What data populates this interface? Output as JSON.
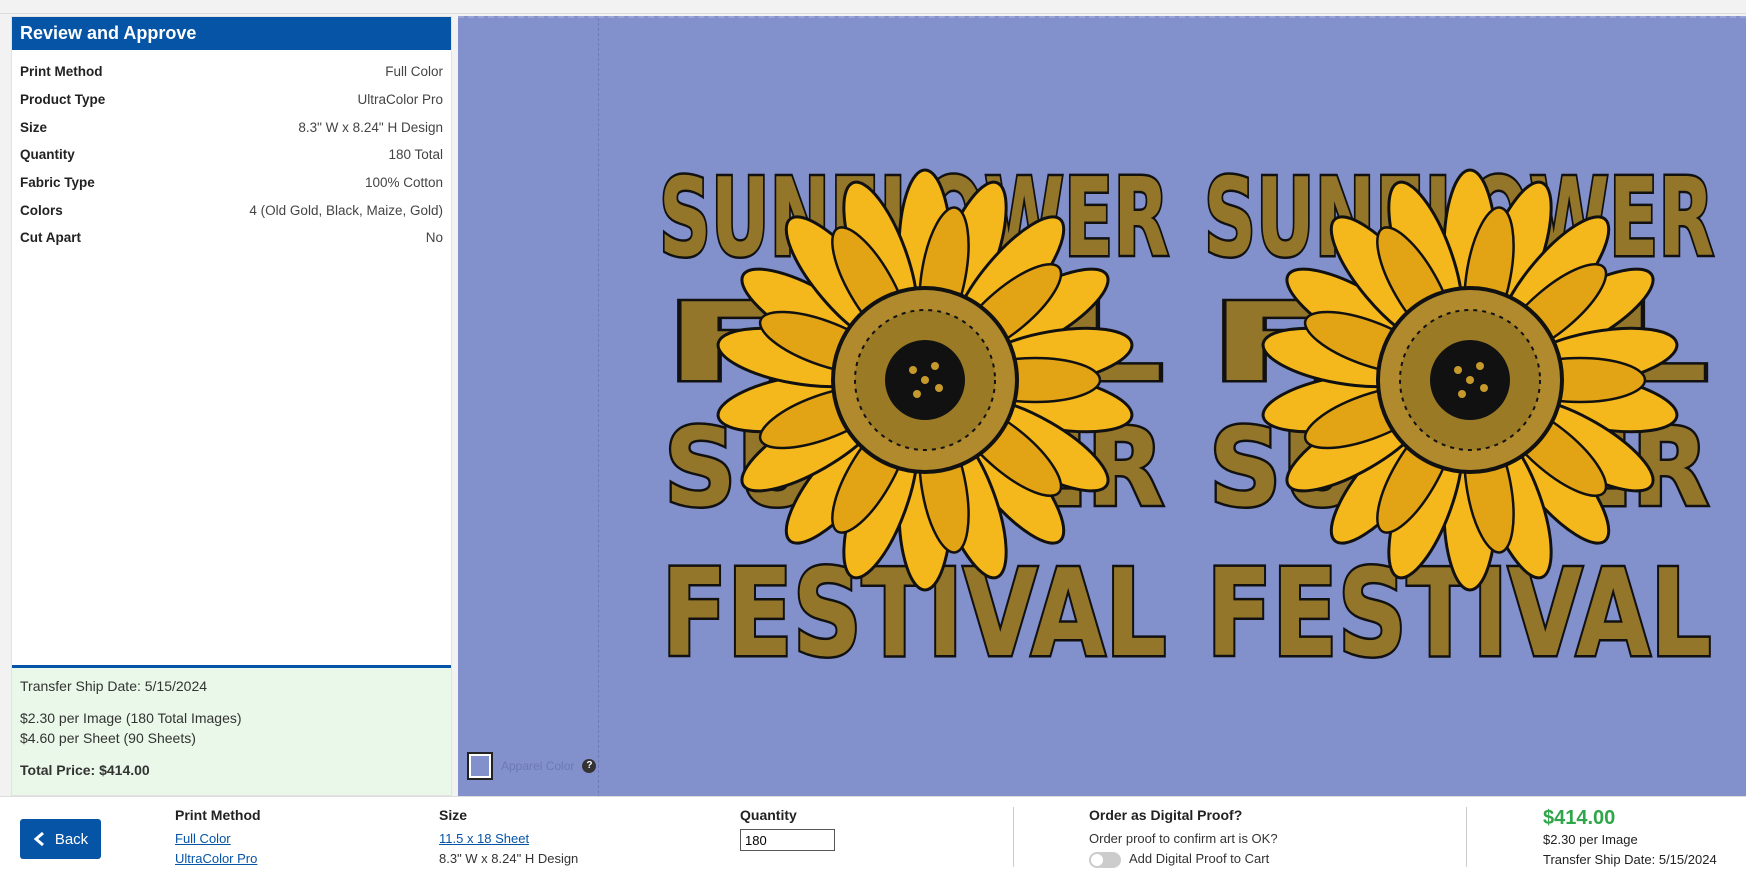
{
  "panel": {
    "title": "Review and Approve",
    "specs": [
      {
        "label": "Print Method",
        "value": "Full Color"
      },
      {
        "label": "Product Type",
        "value": "UltraColor Pro"
      },
      {
        "label": "Size",
        "value": "8.3\" W x 8.24\" H Design"
      },
      {
        "label": "Quantity",
        "value": "180 Total"
      },
      {
        "label": "Fabric Type",
        "value": "100% Cotton"
      },
      {
        "label": "Colors",
        "value": "4 (Old Gold, Black, Maize, Gold)"
      },
      {
        "label": "Cut Apart",
        "value": "No"
      }
    ],
    "summary": {
      "ship_date": "Transfer Ship Date: 5/15/2024",
      "per_image": "$2.30 per Image (180 Total Images)",
      "per_sheet": "$4.60 per Sheet (90 Sheets)",
      "total": "Total Price: $414.00"
    }
  },
  "preview": {
    "apparel_color_label": "Apparel Color",
    "help_glyph": "?",
    "background_color": "#8290cc",
    "design_text": [
      "SUNFLOWER",
      "FALL",
      "SUMMER",
      "FESTIVAL"
    ]
  },
  "bottom": {
    "back_label": "Back",
    "print_method": {
      "title": "Print Method",
      "link1": "Full Color",
      "link2": "UltraColor Pro"
    },
    "size": {
      "title": "Size",
      "link": "11.5 x 18 Sheet",
      "detail": "8.3\" W x 8.24\" H Design"
    },
    "quantity": {
      "title": "Quantity",
      "value": "180"
    },
    "digital_proof": {
      "title": "Order as Digital Proof?",
      "question": "Order proof to confirm art is OK?",
      "toggle_label": "Add Digital Proof to Cart"
    },
    "price": {
      "total": "$414.00",
      "per_image": "$2.30 per Image",
      "ship_date": "Transfer Ship Date: 5/15/2024"
    }
  }
}
